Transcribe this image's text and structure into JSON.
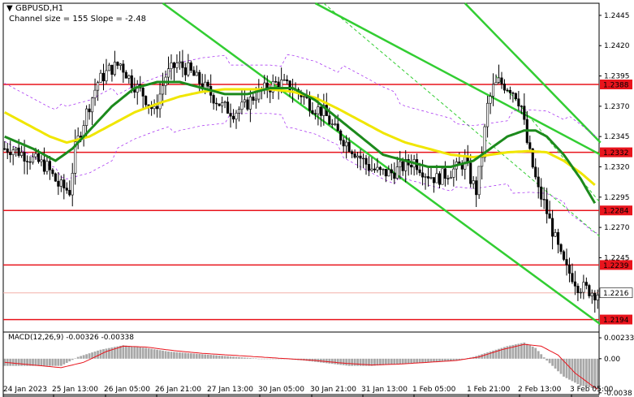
{
  "header": {
    "symbol": "GBPUSD,H1",
    "channel_info": "Channel size = 155 Slope = -2.48"
  },
  "macd": {
    "label": "MACD(12,26,9) -0.00326 -0.00338",
    "axis_ticks": [
      "0.00233",
      "0.00",
      "-0.0038"
    ],
    "axis_values": [
      0.00233,
      0.0,
      -0.0038
    ]
  },
  "colors": {
    "level_line": "#e8141c",
    "level_badge": "#e8141c",
    "ma_fast": "#1c8a1c",
    "ma_slow": "#f0e600",
    "channel": "#32cd32",
    "envelope": "#a020f0",
    "candle": "#000000",
    "macd_hist": "#a8a8a8",
    "macd_signal": "#e8141c"
  },
  "chart_data": {
    "type": "candlestick",
    "symbol": "GBPUSD",
    "timeframe": "H1",
    "ylim": [
      1.2185,
      1.2455
    ],
    "y_ticks": [
      "1.2445",
      "1.2420",
      "1.2395",
      "1.2370",
      "1.2345",
      "1.2320",
      "1.2295",
      "1.2270",
      "1.2245",
      "1.2216",
      "1.2194"
    ],
    "y_tick_values": [
      1.2445,
      1.242,
      1.2395,
      1.237,
      1.2345,
      1.232,
      1.2295,
      1.227,
      1.2245,
      1.2216,
      1.2194
    ],
    "current_price": 1.2216,
    "horizontal_levels": [
      1.2388,
      1.2332,
      1.2284,
      1.2239,
      1.2194
    ],
    "level_labels": [
      "1.2388",
      "1.2332",
      "1.2284",
      "1.2239",
      "1.2194"
    ],
    "x_tick_labels": [
      "24 Jan 2023",
      "25 Jan 13:00",
      "26 Jan 05:00",
      "26 Jan 21:00",
      "27 Jan 13:00",
      "30 Jan 05:00",
      "30 Jan 21:00",
      "31 Jan 13:00",
      "1 Feb 05:00",
      "1 Feb 21:00",
      "2 Feb 13:00",
      "3 Feb 05:00"
    ],
    "price_anchors": [
      [
        0,
        1.2335
      ],
      [
        4,
        1.2335
      ],
      [
        8,
        1.233
      ],
      [
        12,
        1.2325
      ],
      [
        16,
        1.232
      ],
      [
        20,
        1.2305
      ],
      [
        24,
        1.23
      ],
      [
        26,
        1.2335
      ],
      [
        30,
        1.2365
      ],
      [
        34,
        1.239
      ],
      [
        38,
        1.24
      ],
      [
        42,
        1.2405
      ],
      [
        46,
        1.239
      ],
      [
        50,
        1.238
      ],
      [
        54,
        1.2365
      ],
      [
        58,
        1.2395
      ],
      [
        62,
        1.2405
      ],
      [
        66,
        1.24
      ],
      [
        70,
        1.239
      ],
      [
        74,
        1.238
      ],
      [
        78,
        1.237
      ],
      [
        82,
        1.2365
      ],
      [
        86,
        1.237
      ],
      [
        90,
        1.238
      ],
      [
        94,
        1.2385
      ],
      [
        98,
        1.239
      ],
      [
        102,
        1.2385
      ],
      [
        106,
        1.238
      ],
      [
        110,
        1.237
      ],
      [
        114,
        1.2365
      ],
      [
        118,
        1.235
      ],
      [
        122,
        1.234
      ],
      [
        126,
        1.233
      ],
      [
        130,
        1.232
      ],
      [
        134,
        1.2315
      ],
      [
        138,
        1.2315
      ],
      [
        142,
        1.232
      ],
      [
        146,
        1.2325
      ],
      [
        150,
        1.2315
      ],
      [
        154,
        1.231
      ],
      [
        158,
        1.2315
      ],
      [
        162,
        1.232
      ],
      [
        164,
        1.2325
      ],
      [
        166,
        1.231
      ],
      [
        168,
        1.23
      ],
      [
        170,
        1.233
      ],
      [
        172,
        1.237
      ],
      [
        174,
        1.2385
      ],
      [
        176,
        1.239
      ],
      [
        180,
        1.2385
      ],
      [
        182,
        1.238
      ],
      [
        184,
        1.237
      ],
      [
        186,
        1.234
      ],
      [
        188,
        1.232
      ],
      [
        190,
        1.23
      ],
      [
        192,
        1.229
      ],
      [
        194,
        1.2275
      ],
      [
        196,
        1.226
      ],
      [
        198,
        1.2245
      ],
      [
        200,
        1.2235
      ],
      [
        202,
        1.223
      ],
      [
        204,
        1.2222
      ],
      [
        206,
        1.222
      ],
      [
        208,
        1.2218
      ],
      [
        210,
        1.2216
      ]
    ],
    "ma_fast_anchors": [
      [
        0,
        1.2345
      ],
      [
        10,
        1.2335
      ],
      [
        18,
        1.2325
      ],
      [
        24,
        1.2335
      ],
      [
        30,
        1.235
      ],
      [
        38,
        1.237
      ],
      [
        46,
        1.2385
      ],
      [
        54,
        1.239
      ],
      [
        62,
        1.239
      ],
      [
        70,
        1.2385
      ],
      [
        78,
        1.238
      ],
      [
        86,
        1.238
      ],
      [
        94,
        1.2385
      ],
      [
        102,
        1.2385
      ],
      [
        110,
        1.2375
      ],
      [
        118,
        1.236
      ],
      [
        126,
        1.2345
      ],
      [
        134,
        1.233
      ],
      [
        142,
        1.2325
      ],
      [
        150,
        1.232
      ],
      [
        158,
        1.232
      ],
      [
        166,
        1.2325
      ],
      [
        172,
        1.2335
      ],
      [
        178,
        1.2345
      ],
      [
        184,
        1.235
      ],
      [
        188,
        1.235
      ],
      [
        192,
        1.2345
      ],
      [
        198,
        1.233
      ],
      [
        204,
        1.231
      ],
      [
        209,
        1.229
      ]
    ],
    "ma_slow_anchors": [
      [
        0,
        1.2365
      ],
      [
        8,
        1.2355
      ],
      [
        16,
        1.2345
      ],
      [
        22,
        1.234
      ],
      [
        30,
        1.2345
      ],
      [
        38,
        1.2355
      ],
      [
        46,
        1.2365
      ],
      [
        54,
        1.2372
      ],
      [
        62,
        1.2378
      ],
      [
        70,
        1.2382
      ],
      [
        78,
        1.2384
      ],
      [
        86,
        1.2384
      ],
      [
        94,
        1.2384
      ],
      [
        102,
        1.2382
      ],
      [
        110,
        1.2377
      ],
      [
        118,
        1.2368
      ],
      [
        126,
        1.2358
      ],
      [
        134,
        1.2348
      ],
      [
        142,
        1.234
      ],
      [
        150,
        1.2335
      ],
      [
        158,
        1.233
      ],
      [
        166,
        1.2328
      ],
      [
        172,
        1.233
      ],
      [
        178,
        1.2332
      ],
      [
        186,
        1.2333
      ],
      [
        192,
        1.2332
      ],
      [
        198,
        1.2325
      ],
      [
        204,
        1.2315
      ],
      [
        209,
        1.2305
      ]
    ],
    "macd_anchors": [
      [
        0,
        -0.0008
      ],
      [
        20,
        -0.0008
      ],
      [
        26,
        0.0002
      ],
      [
        34,
        0.001
      ],
      [
        42,
        0.0015
      ],
      [
        50,
        0.0012
      ],
      [
        58,
        0.0008
      ],
      [
        66,
        0.0006
      ],
      [
        74,
        0.0004
      ],
      [
        82,
        0.0002
      ],
      [
        90,
        0.0
      ],
      [
        98,
        0.0
      ],
      [
        106,
        -0.0002
      ],
      [
        114,
        -0.0005
      ],
      [
        122,
        -0.0008
      ],
      [
        130,
        -0.0008
      ],
      [
        140,
        -0.0006
      ],
      [
        150,
        -0.0004
      ],
      [
        160,
        -0.0002
      ],
      [
        166,
        0.0002
      ],
      [
        172,
        0.0008
      ],
      [
        178,
        0.0014
      ],
      [
        184,
        0.0018
      ],
      [
        188,
        0.0012
      ],
      [
        192,
        -0.0002
      ],
      [
        198,
        -0.002
      ],
      [
        204,
        -0.003
      ],
      [
        210,
        -0.0034
      ]
    ],
    "signal_anchors": [
      [
        0,
        -0.0004
      ],
      [
        20,
        -0.001
      ],
      [
        28,
        -0.0004
      ],
      [
        36,
        0.0008
      ],
      [
        42,
        0.0014
      ],
      [
        50,
        0.0013
      ],
      [
        60,
        0.0009
      ],
      [
        70,
        0.0006
      ],
      [
        80,
        0.0004
      ],
      [
        90,
        0.0002
      ],
      [
        100,
        0.0
      ],
      [
        110,
        -0.0002
      ],
      [
        120,
        -0.0005
      ],
      [
        130,
        -0.0007
      ],
      [
        140,
        -0.0006
      ],
      [
        150,
        -0.0004
      ],
      [
        160,
        -0.0002
      ],
      [
        168,
        0.0002
      ],
      [
        176,
        0.001
      ],
      [
        184,
        0.0016
      ],
      [
        190,
        0.0014
      ],
      [
        196,
        0.0004
      ],
      [
        202,
        -0.0016
      ],
      [
        208,
        -0.003
      ],
      [
        210,
        -0.0034
      ]
    ]
  }
}
